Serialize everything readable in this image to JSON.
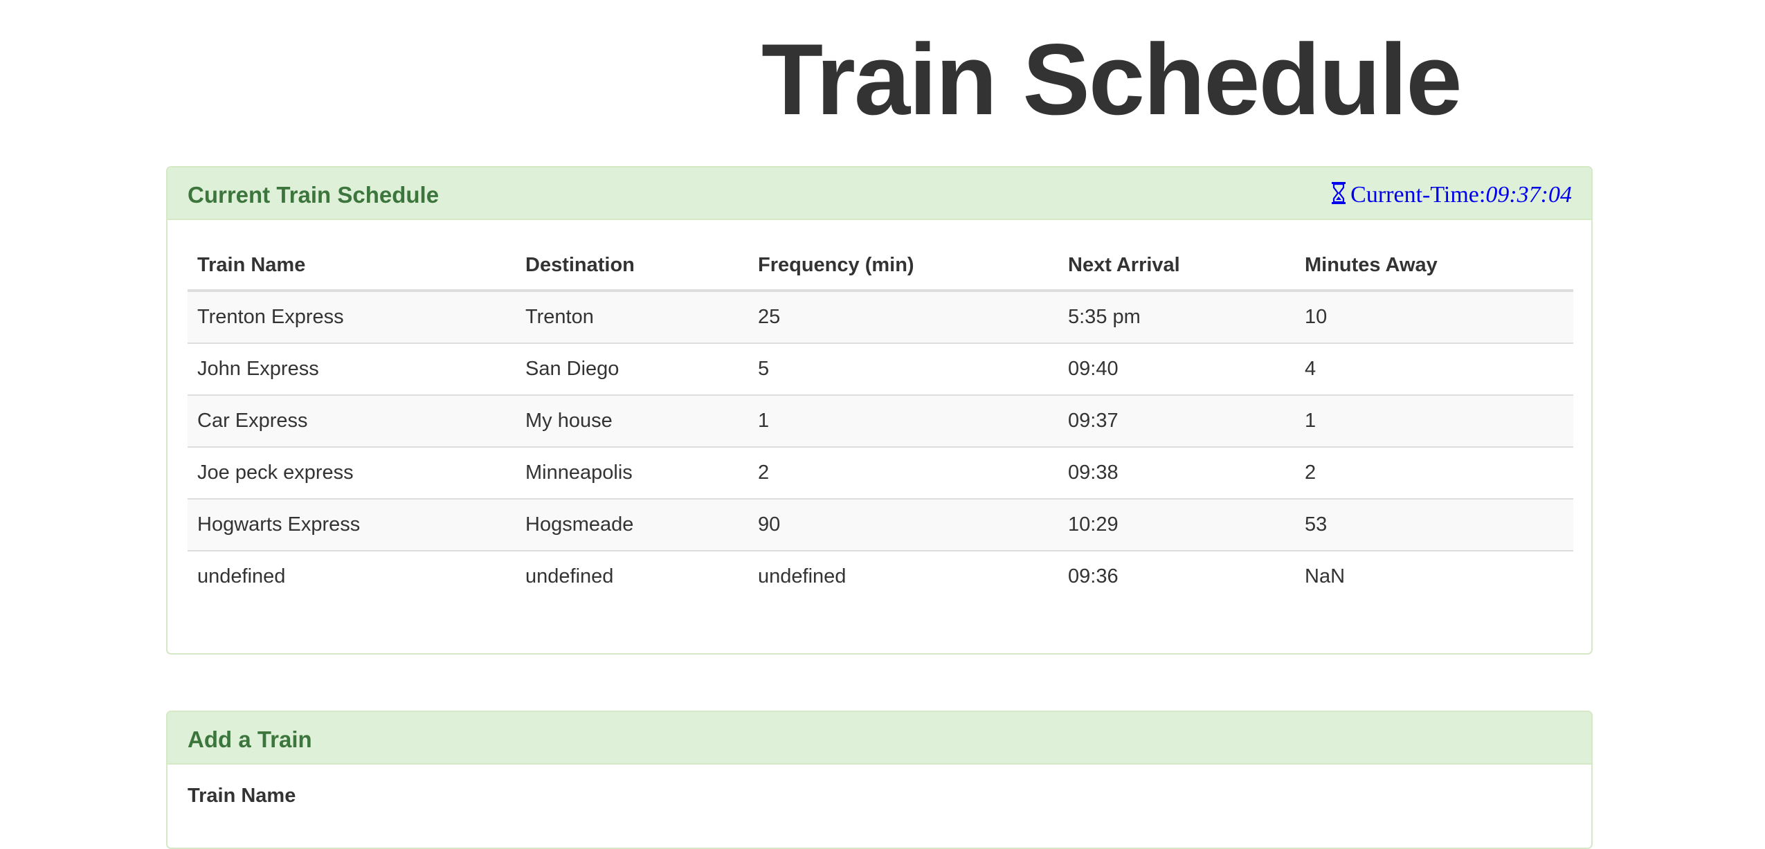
{
  "page": {
    "title": "Train Schedule"
  },
  "schedule_panel": {
    "title": "Current Train Schedule",
    "clock": {
      "label": "Current-Time:",
      "value": "09:37:04",
      "icon": "hourglass-icon",
      "color": "#0000ee"
    },
    "columns": [
      "Train Name",
      "Destination",
      "Frequency (min)",
      "Next Arrival",
      "Minutes Away"
    ],
    "rows": [
      [
        "Trenton Express",
        "Trenton",
        "25",
        "5:35 pm",
        "10"
      ],
      [
        "John Express",
        "San Diego",
        "5",
        "09:40",
        "4"
      ],
      [
        "Car Express",
        "My house",
        "1",
        "09:37",
        "1"
      ],
      [
        "Joe peck express",
        "Minneapolis",
        "2",
        "09:38",
        "2"
      ],
      [
        "Hogwarts Express",
        "Hogsmeade",
        "90",
        "10:29",
        "53"
      ],
      [
        "undefined",
        "undefined",
        "undefined",
        "09:36",
        "NaN"
      ]
    ]
  },
  "add_panel": {
    "title": "Add a Train",
    "fields": {
      "train_name_label": "Train Name"
    }
  },
  "colors": {
    "panel_heading_bg": "#dff0d8",
    "panel_border": "#d6e9c6",
    "panel_title": "#3c763d",
    "text": "#333333"
  }
}
